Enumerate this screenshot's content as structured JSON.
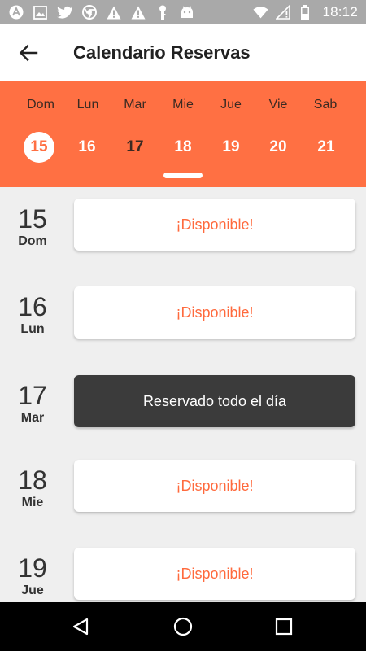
{
  "status_bar": {
    "time": "18:12",
    "left_icons": [
      "app-a-icon",
      "image-icon",
      "twitter-icon",
      "chrome-icon",
      "warning-icon",
      "warning-icon",
      "key-icon",
      "android-icon"
    ],
    "right_icons": [
      "wifi-icon",
      "sim-no-signal-icon",
      "battery-icon"
    ]
  },
  "app_bar": {
    "back_icon": "arrow-back-icon",
    "title": "Calendario Reservas"
  },
  "week": {
    "day_names": [
      "Dom",
      "Lun",
      "Mar",
      "Mie",
      "Jue",
      "Vie",
      "Sab"
    ],
    "day_numbers": [
      "15",
      "16",
      "17",
      "18",
      "19",
      "20",
      "21"
    ],
    "selected_index": 0
  },
  "bookings": [
    {
      "day": "15",
      "weekday": "Dom",
      "status": "¡Disponible!"
    },
    {
      "day": "16",
      "weekday": "Lun",
      "status": "¡Disponible!"
    },
    {
      "day": "17",
      "weekday": "Mar",
      "status": "Reservado todo el día"
    },
    {
      "day": "18",
      "weekday": "Mie",
      "status": "¡Disponible!"
    },
    {
      "day": "19",
      "weekday": "Jue",
      "status": "¡Disponible!"
    }
  ],
  "colors": {
    "accent": "#ff7043",
    "available_text": "#ff6a3d",
    "reserved_bg": "#3b3b3b"
  },
  "nav_bar": {
    "icons": [
      "back-triangle-icon",
      "home-circle-icon",
      "recents-square-icon"
    ]
  }
}
